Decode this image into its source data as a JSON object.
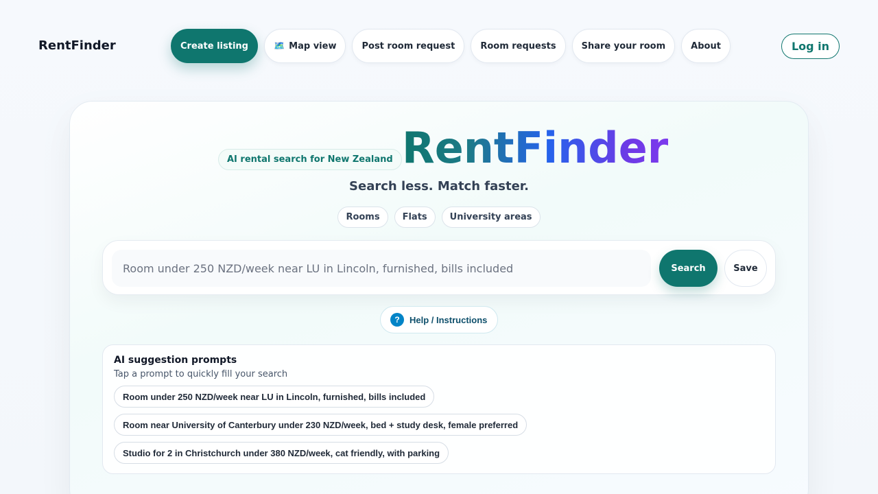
{
  "header": {
    "brand": "RentFinder",
    "nav": [
      {
        "label": "Create listing",
        "name": "nav-create-listing",
        "primary": true
      },
      {
        "label": "Map view",
        "name": "nav-map-view",
        "icon": "map-icon",
        "glyph": "🗺️"
      },
      {
        "label": "Post room request",
        "name": "nav-post-room-request"
      },
      {
        "label": "Room requests",
        "name": "nav-room-requests"
      },
      {
        "label": "Share your room",
        "name": "nav-share-your-room"
      },
      {
        "label": "About",
        "name": "nav-about"
      }
    ],
    "login_label": "Log in"
  },
  "hero": {
    "badge": "AI rental search for New Zealand",
    "title": "RentFinder",
    "subtitle": "Search less. Match faster.",
    "chips": [
      "Rooms",
      "Flats",
      "University areas"
    ]
  },
  "search": {
    "placeholder": "Room under 250 NZD/week near LU in Lincoln, furnished, bills included",
    "value": "",
    "search_label": "Search",
    "save_label": "Save"
  },
  "help": {
    "icon_glyph": "?",
    "label": "Help / Instructions"
  },
  "suggestions": {
    "title": "AI suggestion prompts",
    "subtitle": "Tap a prompt to quickly fill your search",
    "prompts": [
      "Room under 250 NZD/week near LU in Lincoln, furnished, bills included",
      "Room near University of Canterbury under 230 NZD/week, bed + study desk, female preferred",
      "Studio for 2 in Christchurch under 380 NZD/week, cat friendly, with parking"
    ]
  },
  "colors": {
    "accent": "#0f766e",
    "help_icon": "#0284c7",
    "title_gradient_start": "#0f766e",
    "title_gradient_mid": "#2563eb",
    "title_gradient_end": "#7c3aed"
  }
}
